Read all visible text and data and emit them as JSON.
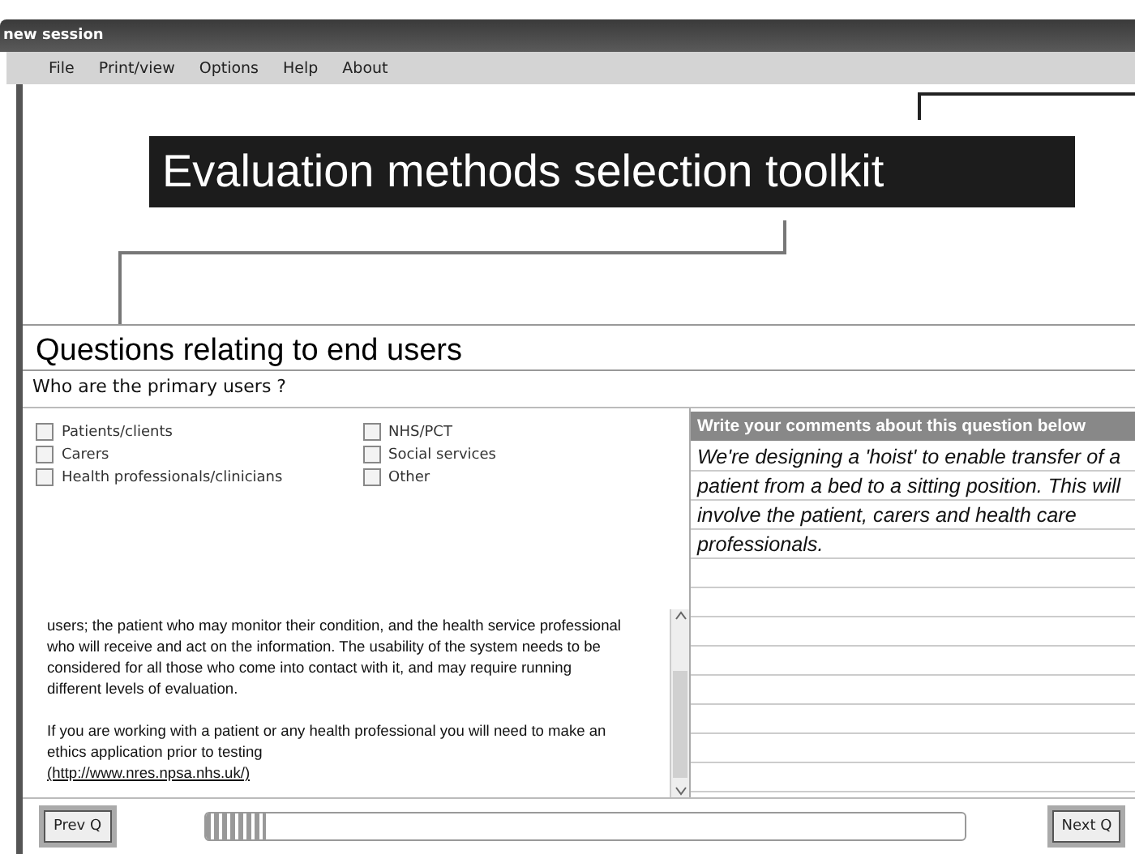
{
  "window": {
    "title": "new session"
  },
  "menu": [
    "File",
    "Print/view",
    "Options",
    "Help",
    "About"
  ],
  "banner": {
    "title": "Evaluation methods selection toolkit"
  },
  "section": {
    "title": "Questions relating to end users",
    "question": "Who are the primary users ?"
  },
  "options": [
    {
      "label": "Patients/clients",
      "checked": false
    },
    {
      "label": "Carers",
      "checked": false
    },
    {
      "label": "Health professionals/clinicians",
      "checked": false
    },
    {
      "label": "NHS/PCT",
      "checked": false
    },
    {
      "label": "Social services",
      "checked": false
    },
    {
      "label": "Other",
      "checked": false
    }
  ],
  "guidance": {
    "paragraphs": [
      "users; the patient who may monitor their condition, and the health service professional who will receive and act on the information. The usability of the system needs to be considered for all those who come into contact with it, and may require running different levels of evaluation.",
      "If you are working with a patient or any health professional you will need to make an ethics application prior to testing"
    ],
    "link": "(http://www.nres.npsa.nhs.uk/)"
  },
  "comments": {
    "heading": "Write your comments about this question below",
    "value": "We're designing a 'hoist' to enable transfer of a patient from a bed to a sitting position. This will involve the patient, carers and health care professionals."
  },
  "navigation": {
    "prev": "Prev Q",
    "next": "Next Q",
    "progress": {
      "level": 0.08
    }
  }
}
